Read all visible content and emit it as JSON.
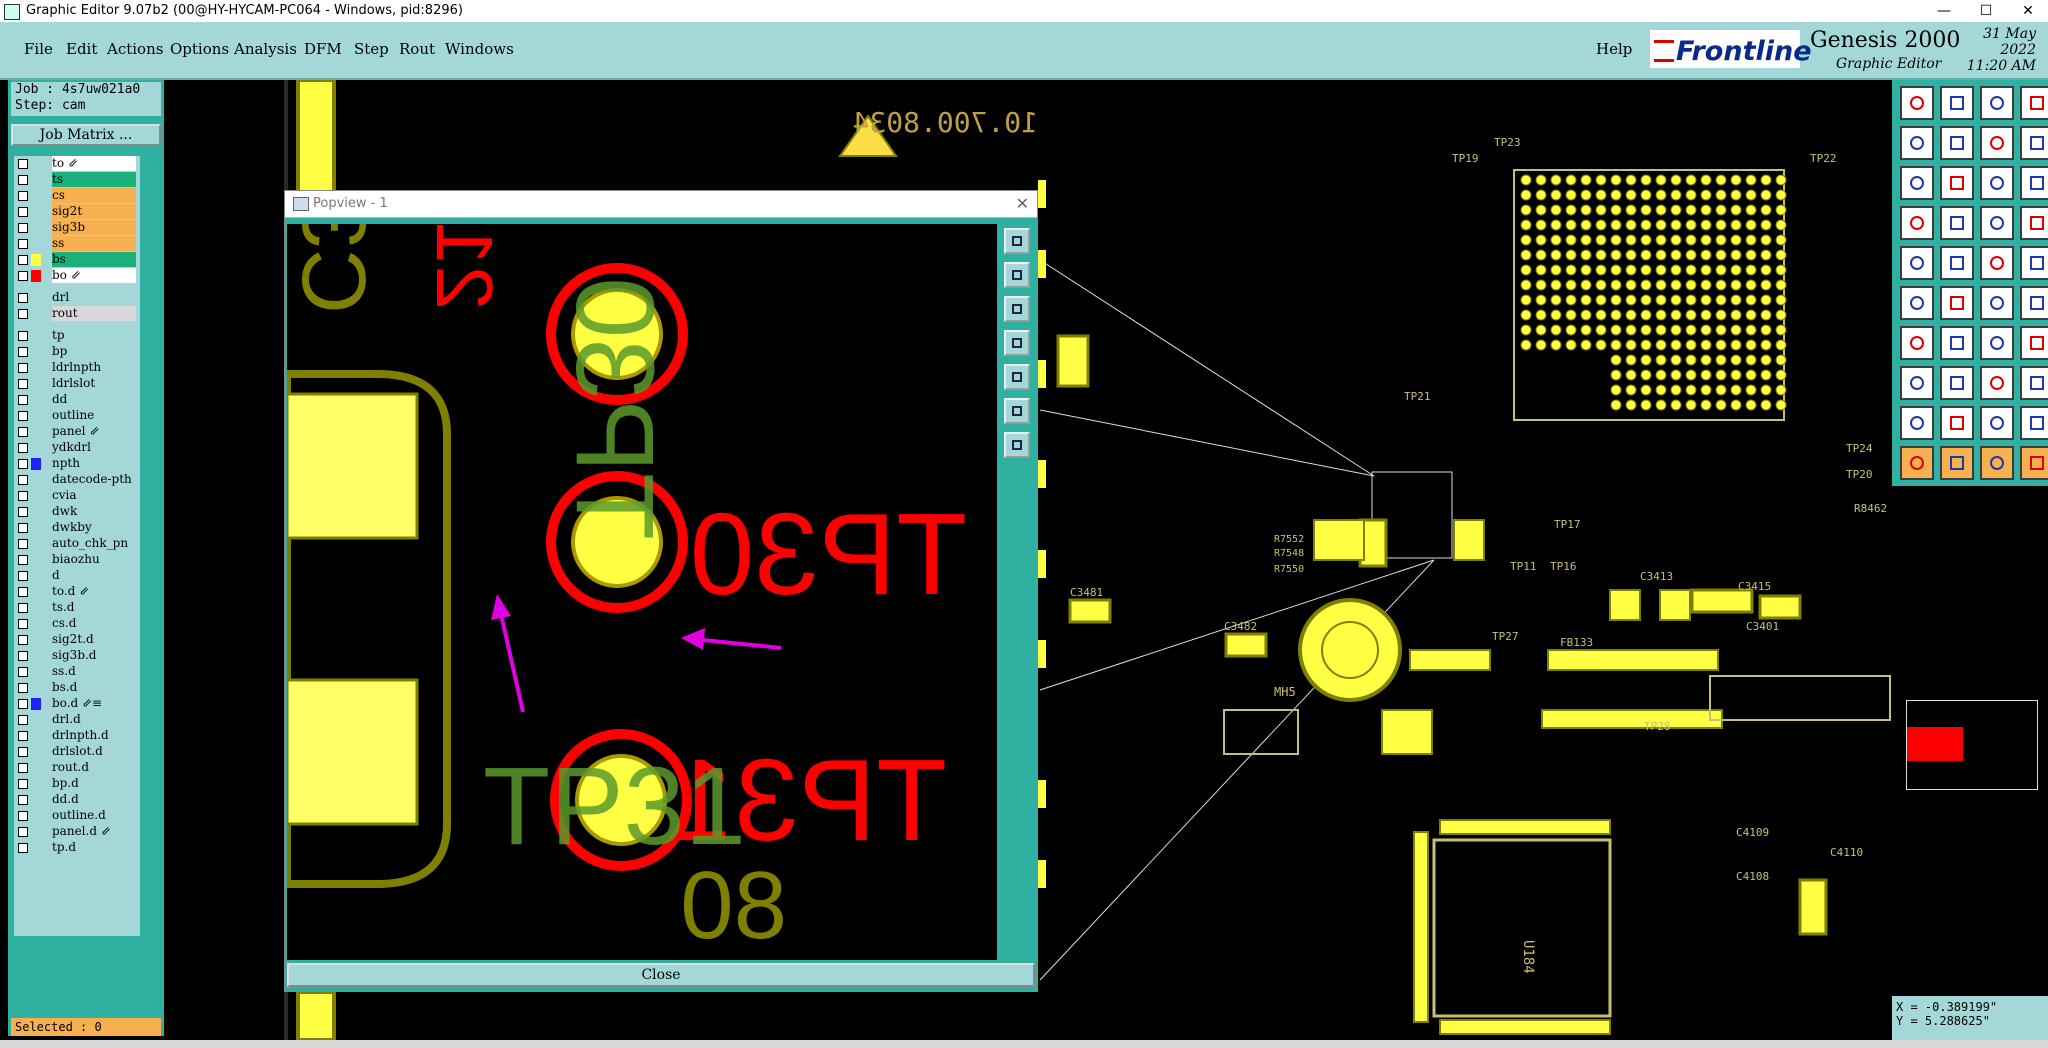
{
  "window": {
    "title": "Graphic Editor 9.07b2 (00@HY-HYCAM-PC064 - Windows, pid:8296)",
    "minimize": "—",
    "maximize": "☐",
    "close": "✕"
  },
  "menu": {
    "items": [
      "File",
      "Edit",
      "Actions",
      "Options",
      "Analysis",
      "DFM",
      "Step",
      "Rout",
      "Windows"
    ],
    "help": "Help"
  },
  "brand": {
    "logo": "Frontline",
    "product": "Genesis 2000",
    "subtitle": "Graphic Editor",
    "date": "31 May 2022",
    "time": "11:20 AM"
  },
  "job": {
    "job_label": "Job : 4s7uw021a0",
    "step_label": "Step: cam",
    "matrix_button": "Job Matrix ..."
  },
  "layers": [
    {
      "name": "to",
      "color": "#ffffff",
      "active": true,
      "flag": "⇙"
    },
    {
      "name": "ts",
      "color": "#19b07a",
      "active": false,
      "flag": ""
    },
    {
      "name": "cs",
      "color": "#f6b050",
      "active": false,
      "flag": ""
    },
    {
      "name": "sig2t",
      "color": "#f6b050",
      "active": false,
      "flag": ""
    },
    {
      "name": "sig3b",
      "color": "#f6b050",
      "active": false,
      "flag": ""
    },
    {
      "name": "ss",
      "color": "#f6b050",
      "active": false,
      "flag": ""
    },
    {
      "name": "bs",
      "color": "#19b07a",
      "active": false,
      "flag": ""
    },
    {
      "name": "bo",
      "color": "#ffffff",
      "active": true,
      "flag": "⇙"
    },
    {
      "name": "drl",
      "color": "#a4d8d8",
      "active": false,
      "flag": ""
    },
    {
      "name": "rout",
      "color": "#d8d8d8",
      "active": false,
      "flag": ""
    },
    {
      "name": "tp",
      "color": "#a4d8d8",
      "active": false,
      "flag": ""
    },
    {
      "name": "bp",
      "color": "#a4d8d8",
      "active": false,
      "flag": ""
    },
    {
      "name": "ldrlnpth",
      "color": "#a4d8d8",
      "active": false,
      "flag": ""
    },
    {
      "name": "ldrlslot",
      "color": "#a4d8d8",
      "active": false,
      "flag": ""
    },
    {
      "name": "dd",
      "color": "#a4d8d8",
      "active": false,
      "flag": ""
    },
    {
      "name": "outline",
      "color": "#a4d8d8",
      "active": false,
      "flag": ""
    },
    {
      "name": "panel",
      "color": "#a4d8d8",
      "active": false,
      "flag": "⇙"
    },
    {
      "name": "ydkdrl",
      "color": "#a4d8d8",
      "active": false,
      "flag": ""
    },
    {
      "name": "npth",
      "color": "#a4d8d8",
      "active": false,
      "flag": ""
    },
    {
      "name": "datecode-pth",
      "color": "#a4d8d8",
      "active": false,
      "flag": ""
    },
    {
      "name": "cvia",
      "color": "#a4d8d8",
      "active": false,
      "flag": ""
    },
    {
      "name": "dwk",
      "color": "#a4d8d8",
      "active": false,
      "flag": ""
    },
    {
      "name": "dwkby",
      "color": "#a4d8d8",
      "active": false,
      "flag": ""
    },
    {
      "name": "auto_chk_pn",
      "color": "#a4d8d8",
      "active": false,
      "flag": ""
    },
    {
      "name": "biaozhu",
      "color": "#a4d8d8",
      "active": false,
      "flag": ""
    },
    {
      "name": "d",
      "color": "#a4d8d8",
      "active": false,
      "flag": ""
    },
    {
      "name": "to.d",
      "color": "#a4d8d8",
      "active": false,
      "flag": "⇙"
    },
    {
      "name": "ts.d",
      "color": "#a4d8d8",
      "active": false,
      "flag": ""
    },
    {
      "name": "cs.d",
      "color": "#a4d8d8",
      "active": false,
      "flag": ""
    },
    {
      "name": "sig2t.d",
      "color": "#a4d8d8",
      "active": false,
      "flag": ""
    },
    {
      "name": "sig3b.d",
      "color": "#a4d8d8",
      "active": false,
      "flag": ""
    },
    {
      "name": "ss.d",
      "color": "#a4d8d8",
      "active": false,
      "flag": ""
    },
    {
      "name": "bs.d",
      "color": "#a4d8d8",
      "active": false,
      "flag": ""
    },
    {
      "name": "bo.d",
      "color": "#a4d8d8",
      "active": false,
      "flag": "⇙≡"
    },
    {
      "name": "drl.d",
      "color": "#a4d8d8",
      "active": false,
      "flag": ""
    },
    {
      "name": "drlnpth.d",
      "color": "#a4d8d8",
      "active": false,
      "flag": ""
    },
    {
      "name": "drlslot.d",
      "color": "#a4d8d8",
      "active": false,
      "flag": ""
    },
    {
      "name": "rout.d",
      "color": "#a4d8d8",
      "active": false,
      "flag": ""
    },
    {
      "name": "bp.d",
      "color": "#a4d8d8",
      "active": false,
      "flag": ""
    },
    {
      "name": "dd.d",
      "color": "#a4d8d8",
      "active": false,
      "flag": ""
    },
    {
      "name": "outline.d",
      "color": "#a4d8d8",
      "active": false,
      "flag": ""
    },
    {
      "name": "panel.d",
      "color": "#a4d8d8",
      "active": false,
      "flag": "⇙"
    },
    {
      "name": "tp.d",
      "color": "#a4d8d8",
      "active": false,
      "flag": ""
    }
  ],
  "selected": "Selected : 0",
  "popview": {
    "title": "Popview - 1",
    "close_button": "Close",
    "labels": {
      "tp30": "TP30",
      "tp31": "TP31",
      "mirror_a": "TP30",
      "mirror_b": "TP31",
      "silk_a": "C3",
      "silk_b": "80",
      "silk_c": "21"
    }
  },
  "board": {
    "part_number": "10.700.8034",
    "labels": [
      "TP19",
      "TP23",
      "TP22",
      "TP24",
      "TP20",
      "TP17",
      "TP11",
      "TP16",
      "TP27",
      "TP21",
      "TP28",
      "U184",
      "C4109",
      "C4108",
      "C4110",
      "C3413",
      "C3401",
      "C3415",
      "C3481",
      "C3482",
      "R8462",
      "R7552",
      "R7548",
      "R7550",
      "MH5",
      "FB133"
    ]
  },
  "coords": {
    "x": "X = -0.389199\"",
    "y": "Y = 5.288625\""
  },
  "colors": {
    "panel": "#a4d8d8",
    "accent": "#2fb0a0",
    "pad": "#ffff44",
    "outline": "#808000",
    "silk": "#ff0000",
    "mask": "#5a9a2a",
    "arrow": "#e000e0"
  }
}
